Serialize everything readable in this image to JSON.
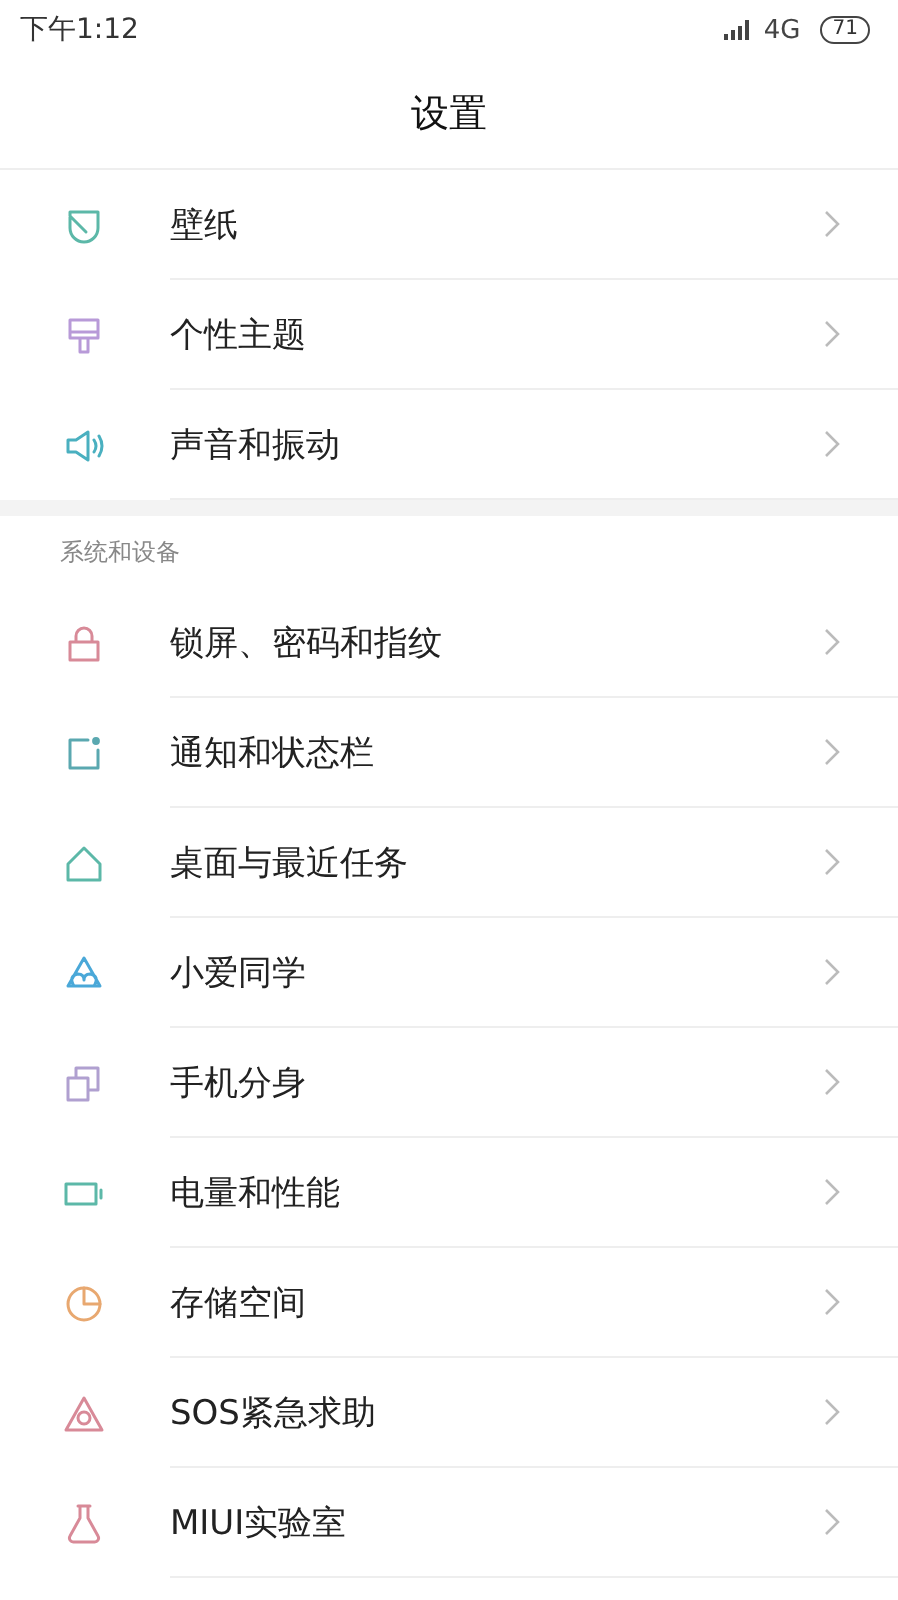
{
  "status_bar": {
    "time": "下午1:12",
    "network": "4G",
    "battery": "71"
  },
  "title": "设置",
  "sections": [
    {
      "items": [
        {
          "label": "壁纸",
          "kind": "wallpaper",
          "color": "#5cb8a8"
        },
        {
          "label": "个性主题",
          "kind": "theme",
          "color": "#b89ad8"
        },
        {
          "label": "声音和振动",
          "kind": "sound",
          "color": "#4ab0c0"
        }
      ]
    },
    {
      "header": "系统和设备",
      "items": [
        {
          "label": "锁屏、密码和指纹",
          "kind": "lock",
          "color": "#d88a98"
        },
        {
          "label": "通知和状态栏",
          "kind": "notification",
          "color": "#5aa8b0"
        },
        {
          "label": "桌面与最近任务",
          "kind": "home",
          "color": "#5cb8a8"
        },
        {
          "label": "小爱同学",
          "kind": "assistant",
          "color": "#4aa8d8"
        },
        {
          "label": "手机分身",
          "kind": "dual",
          "color": "#b0a0d0"
        },
        {
          "label": "电量和性能",
          "kind": "battery",
          "color": "#5cb8a8"
        },
        {
          "label": "存储空间",
          "kind": "storage",
          "color": "#e8a870"
        },
        {
          "label": "SOS紧急求助",
          "kind": "sos",
          "color": "#d88a98"
        },
        {
          "label": "MIUI实验室",
          "kind": "lab",
          "color": "#d88a98"
        }
      ]
    }
  ]
}
